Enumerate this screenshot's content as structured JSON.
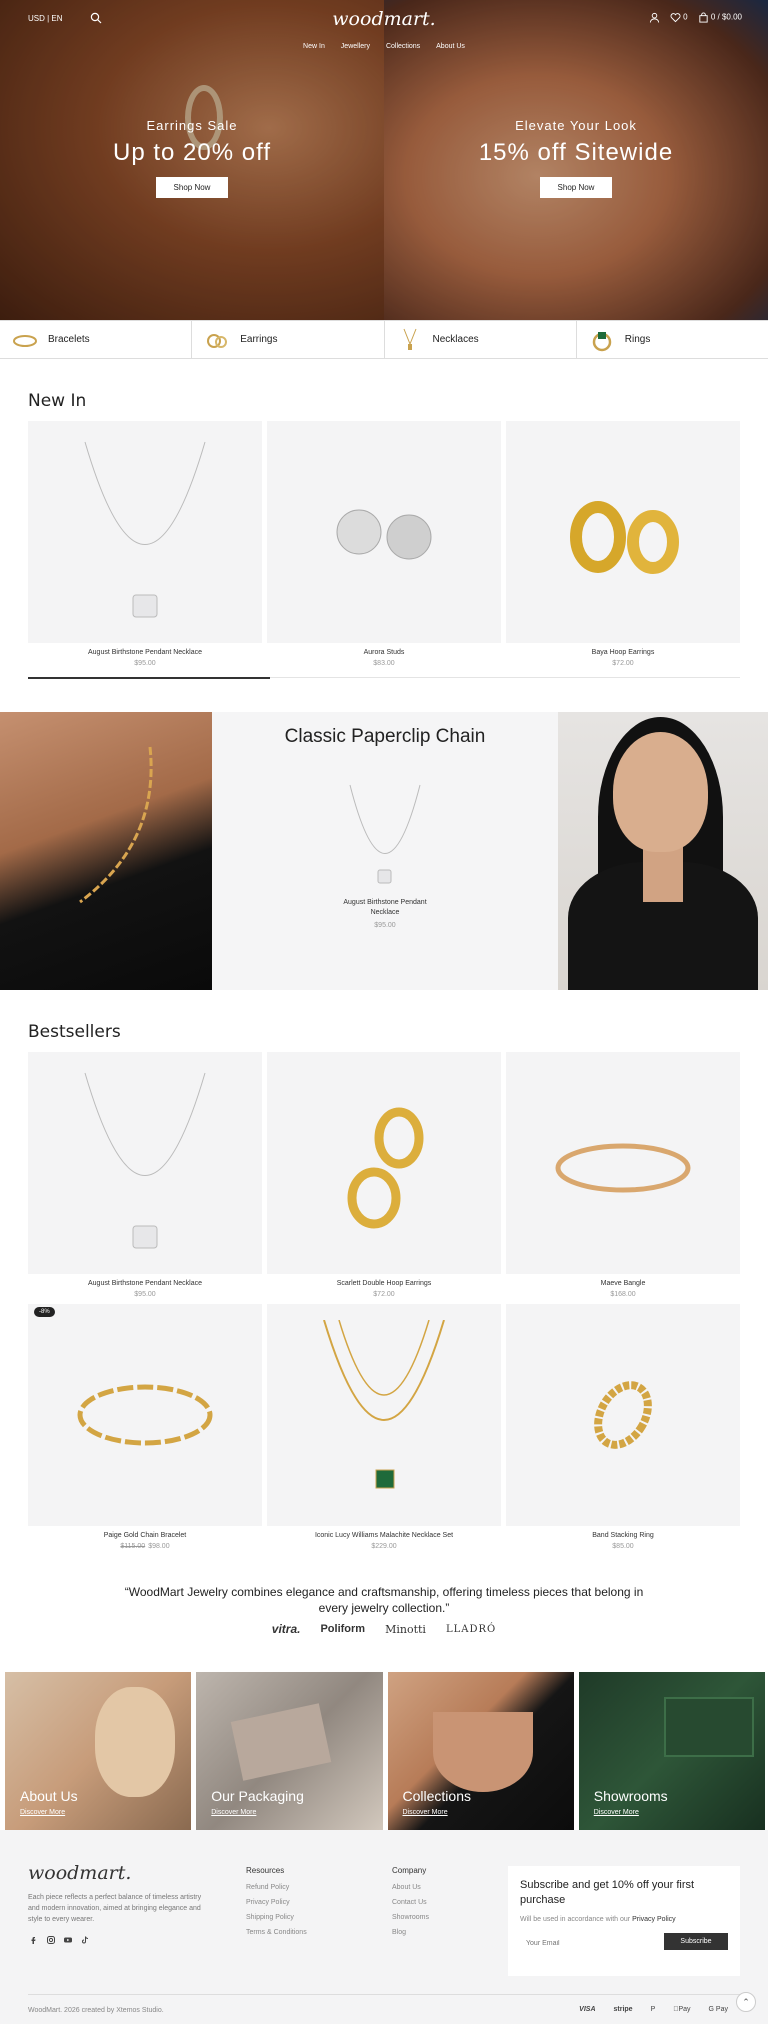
{
  "header": {
    "currency_lang": "USD | EN",
    "logo": "woodmart.",
    "nav": [
      "New In",
      "Jewellery",
      "Collections",
      "About Us"
    ],
    "wishlist_count": "0",
    "cart": "0 / $0.00"
  },
  "hero": [
    {
      "kicker": "Earrings Sale",
      "title": "Up to 20% off",
      "button": "Shop Now"
    },
    {
      "kicker": "Elevate Your Look",
      "title": "15% off Sitewide",
      "button": "Shop Now"
    }
  ],
  "categories": [
    {
      "label": "Bracelets",
      "icon": "bracelet-icon"
    },
    {
      "label": "Earrings",
      "icon": "earring-icon"
    },
    {
      "label": "Necklaces",
      "icon": "necklace-icon"
    },
    {
      "label": "Rings",
      "icon": "ring-icon"
    }
  ],
  "new_in": {
    "title": "New In",
    "products": [
      {
        "name": "August Birthstone Pendant Necklace",
        "price": "$95.00"
      },
      {
        "name": "Aurora Studs",
        "price": "$83.00"
      },
      {
        "name": "Baya Hoop Earrings",
        "price": "$72.00"
      }
    ],
    "carousel_progress": 0.34
  },
  "paperclip": {
    "title": "Classic Paperclip Chain",
    "product_name": "August Birthstone Pendant Necklace",
    "product_price": "$95.00"
  },
  "bestsellers": {
    "title": "Bestsellers",
    "products": [
      {
        "name": "August Birthstone Pendant Necklace",
        "price": "$95.00",
        "old_price": "",
        "badge": ""
      },
      {
        "name": "Scarlett Double Hoop Earrings",
        "price": "$72.00",
        "old_price": "",
        "badge": ""
      },
      {
        "name": "Maeve Bangle",
        "price": "$168.00",
        "old_price": "",
        "badge": ""
      },
      {
        "name": "Paige Gold Chain Bracelet",
        "price": "$98.00",
        "old_price": "$115.00",
        "badge": "-8%"
      },
      {
        "name": "Iconic Lucy Williams Malachite Necklace Set",
        "price": "$229.00",
        "old_price": "",
        "badge": ""
      },
      {
        "name": "Band Stacking Ring",
        "price": "$85.00",
        "old_price": "",
        "badge": ""
      }
    ]
  },
  "testimonial": {
    "quote": "“WoodMart Jewelry combines elegance and craftsmanship, offering timeless pieces that belong in every jewelry collection.”",
    "brands": [
      "vitra.",
      "Poliform",
      "Minotti",
      "LLADRÓ"
    ]
  },
  "tiles": [
    {
      "title": "About Us",
      "link": "Discover More"
    },
    {
      "title": "Our Packaging",
      "link": "Discover More"
    },
    {
      "title": "Collections",
      "link": "Discover More"
    },
    {
      "title": "Showrooms",
      "link": "Discover More"
    }
  ],
  "footer": {
    "logo": "woodmart.",
    "description": "Each piece reflects a perfect balance of timeless artistry and modern innovation, aimed at bringing elegance and style to every wearer.",
    "resources_title": "Resources",
    "resources": [
      "Refund Policy",
      "Privacy Policy",
      "Shipping Policy",
      "Terms & Conditions"
    ],
    "company_title": "Company",
    "company": [
      "About Us",
      "Contact Us",
      "Showrooms",
      "Blog"
    ],
    "subscribe_title": "Subscribe and get 10% off your first purchase",
    "subscribe_note": "Will be used in accordance with our",
    "subscribe_note_link": "Privacy Policy",
    "email_placeholder": "Your Email",
    "subscribe_button": "Subscribe",
    "copyright": "WoodMart. 2026 created by Xtemos Studio.",
    "payments": [
      "VISA",
      "stripe",
      "P",
      "Pay",
      "G Pay"
    ]
  }
}
